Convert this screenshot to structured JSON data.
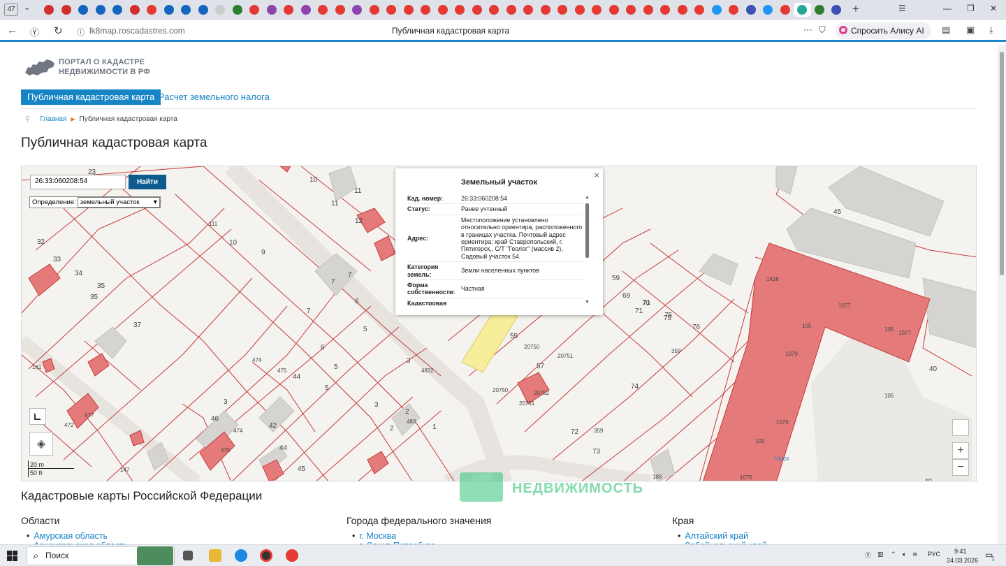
{
  "browser": {
    "tab_count": "47",
    "tab_icon_colors": [
      "#d32f2f",
      "#d32f2f",
      "#1565c0",
      "#1565c0",
      "#1565c0",
      "#d32f2f",
      "#e53935",
      "#1565c0",
      "#1565c0",
      "#1565c0",
      "#cccccc",
      "#2e7d32",
      "#e53935",
      "#8e44ad",
      "#e53935",
      "#8e44ad",
      "#e53935",
      "#e53935",
      "#8e44ad",
      "#e53935",
      "#e53935",
      "#e53935",
      "#e53935",
      "#e53935",
      "#e53935",
      "#e53935",
      "#e53935",
      "#e53935",
      "#e53935",
      "#e53935",
      "#e53935",
      "#e53935",
      "#e53935",
      "#e53935",
      "#e53935",
      "#e53935",
      "#e53935",
      "#e53935",
      "#e53935",
      "#2196f3",
      "#e53935",
      "#3f51b5",
      "#2196f3",
      "#e53935",
      "#26a69a",
      "#2e7d32",
      "#3f51b5"
    ],
    "url": "lk8map.roscadastres.com",
    "page_title": "Публичная кадастровая карта",
    "alice_label": "Спросить Алису AI"
  },
  "site": {
    "logo_line1": "ПОРТАЛ О КАДАСТРЕ",
    "logo_line2": "НЕДВИЖИМОСТИ В РФ",
    "nav_active": "Публичная кадастровая карта",
    "nav_link": "Расчет земельного налога",
    "crumb_home": "Главная",
    "crumb_current": "Публичная кадастровая карта",
    "heading": "Публичная кадастровая карта"
  },
  "map": {
    "search_value": "26:33:060208:54",
    "find_label": "Найти",
    "definition_label": "Определение:",
    "definition_value": "земельный участок",
    "scale_m": "20 m",
    "scale_ft": "50 ft",
    "zoom_in": "+",
    "zoom_out": "−",
    "popup": {
      "title": "Земельный участок",
      "close": "×",
      "rows": [
        {
          "k": "Кад. номер:",
          "v": "26:33:060208:54"
        },
        {
          "k": "Статус:",
          "v": "Ранее учтенный"
        },
        {
          "k": "Адрес:",
          "v": "Местоположение установлено относительно ориентира, расположенного в границах участка. Почтовый адрес ориентира: край Ставропольский, г. Пятигорск,, С/Т \"Геолог\" (массив 2), Садовый участок 54."
        },
        {
          "k": "Категория земель:",
          "v": "Земли населенных пунктов"
        },
        {
          "k": "Форма собственности:",
          "v": "Частная"
        },
        {
          "k": "Кадастровая",
          "v": ""
        }
      ]
    },
    "labels": [
      "23",
      "10",
      "11",
      "11",
      "12",
      "33",
      "34",
      "35",
      "35",
      "37",
      "32",
      "111",
      "10",
      "9",
      "7",
      "7",
      "7",
      "6",
      "5",
      "6",
      "5",
      "474",
      "475",
      "44",
      "5",
      "3",
      "4832",
      "3",
      "2",
      "483",
      "1",
      "2",
      "3",
      "42",
      "44",
      "45",
      "46",
      "474",
      "475",
      "477",
      "472",
      "147",
      "161",
      "59",
      "69",
      "70",
      "71",
      "71",
      "75",
      "75",
      "76",
      "359",
      "74",
      "72",
      "73",
      "359",
      "20750",
      "20751",
      "20750",
      "20751",
      "20752",
      "55",
      "57",
      "45",
      "105",
      "105",
      "1077",
      "1077",
      "1079",
      "1075",
      "105",
      "1076",
      "188",
      "40",
      "40",
      "105",
      "1416"
    ],
    "street_fragment": "горск"
  },
  "watermark": "НЕДВИЖИМОСТЬ",
  "lower": {
    "section_title": "Кадастровые карты Российской Федерации",
    "col1_title": "Области",
    "col1_items": [
      "Амурская область",
      "Архангельская область"
    ],
    "col2_title": "Города федерального значения",
    "col2_items": [
      "г. Москва",
      "г. Санкт-Петербург"
    ],
    "col3_title": "Края",
    "col3_items": [
      "Алтайский край",
      "Забайкальский край"
    ]
  },
  "taskbar": {
    "search_label": "Поиск",
    "lang": "РУС",
    "time": "9:41",
    "date": "24.03.2026",
    "notif_count": "1"
  }
}
